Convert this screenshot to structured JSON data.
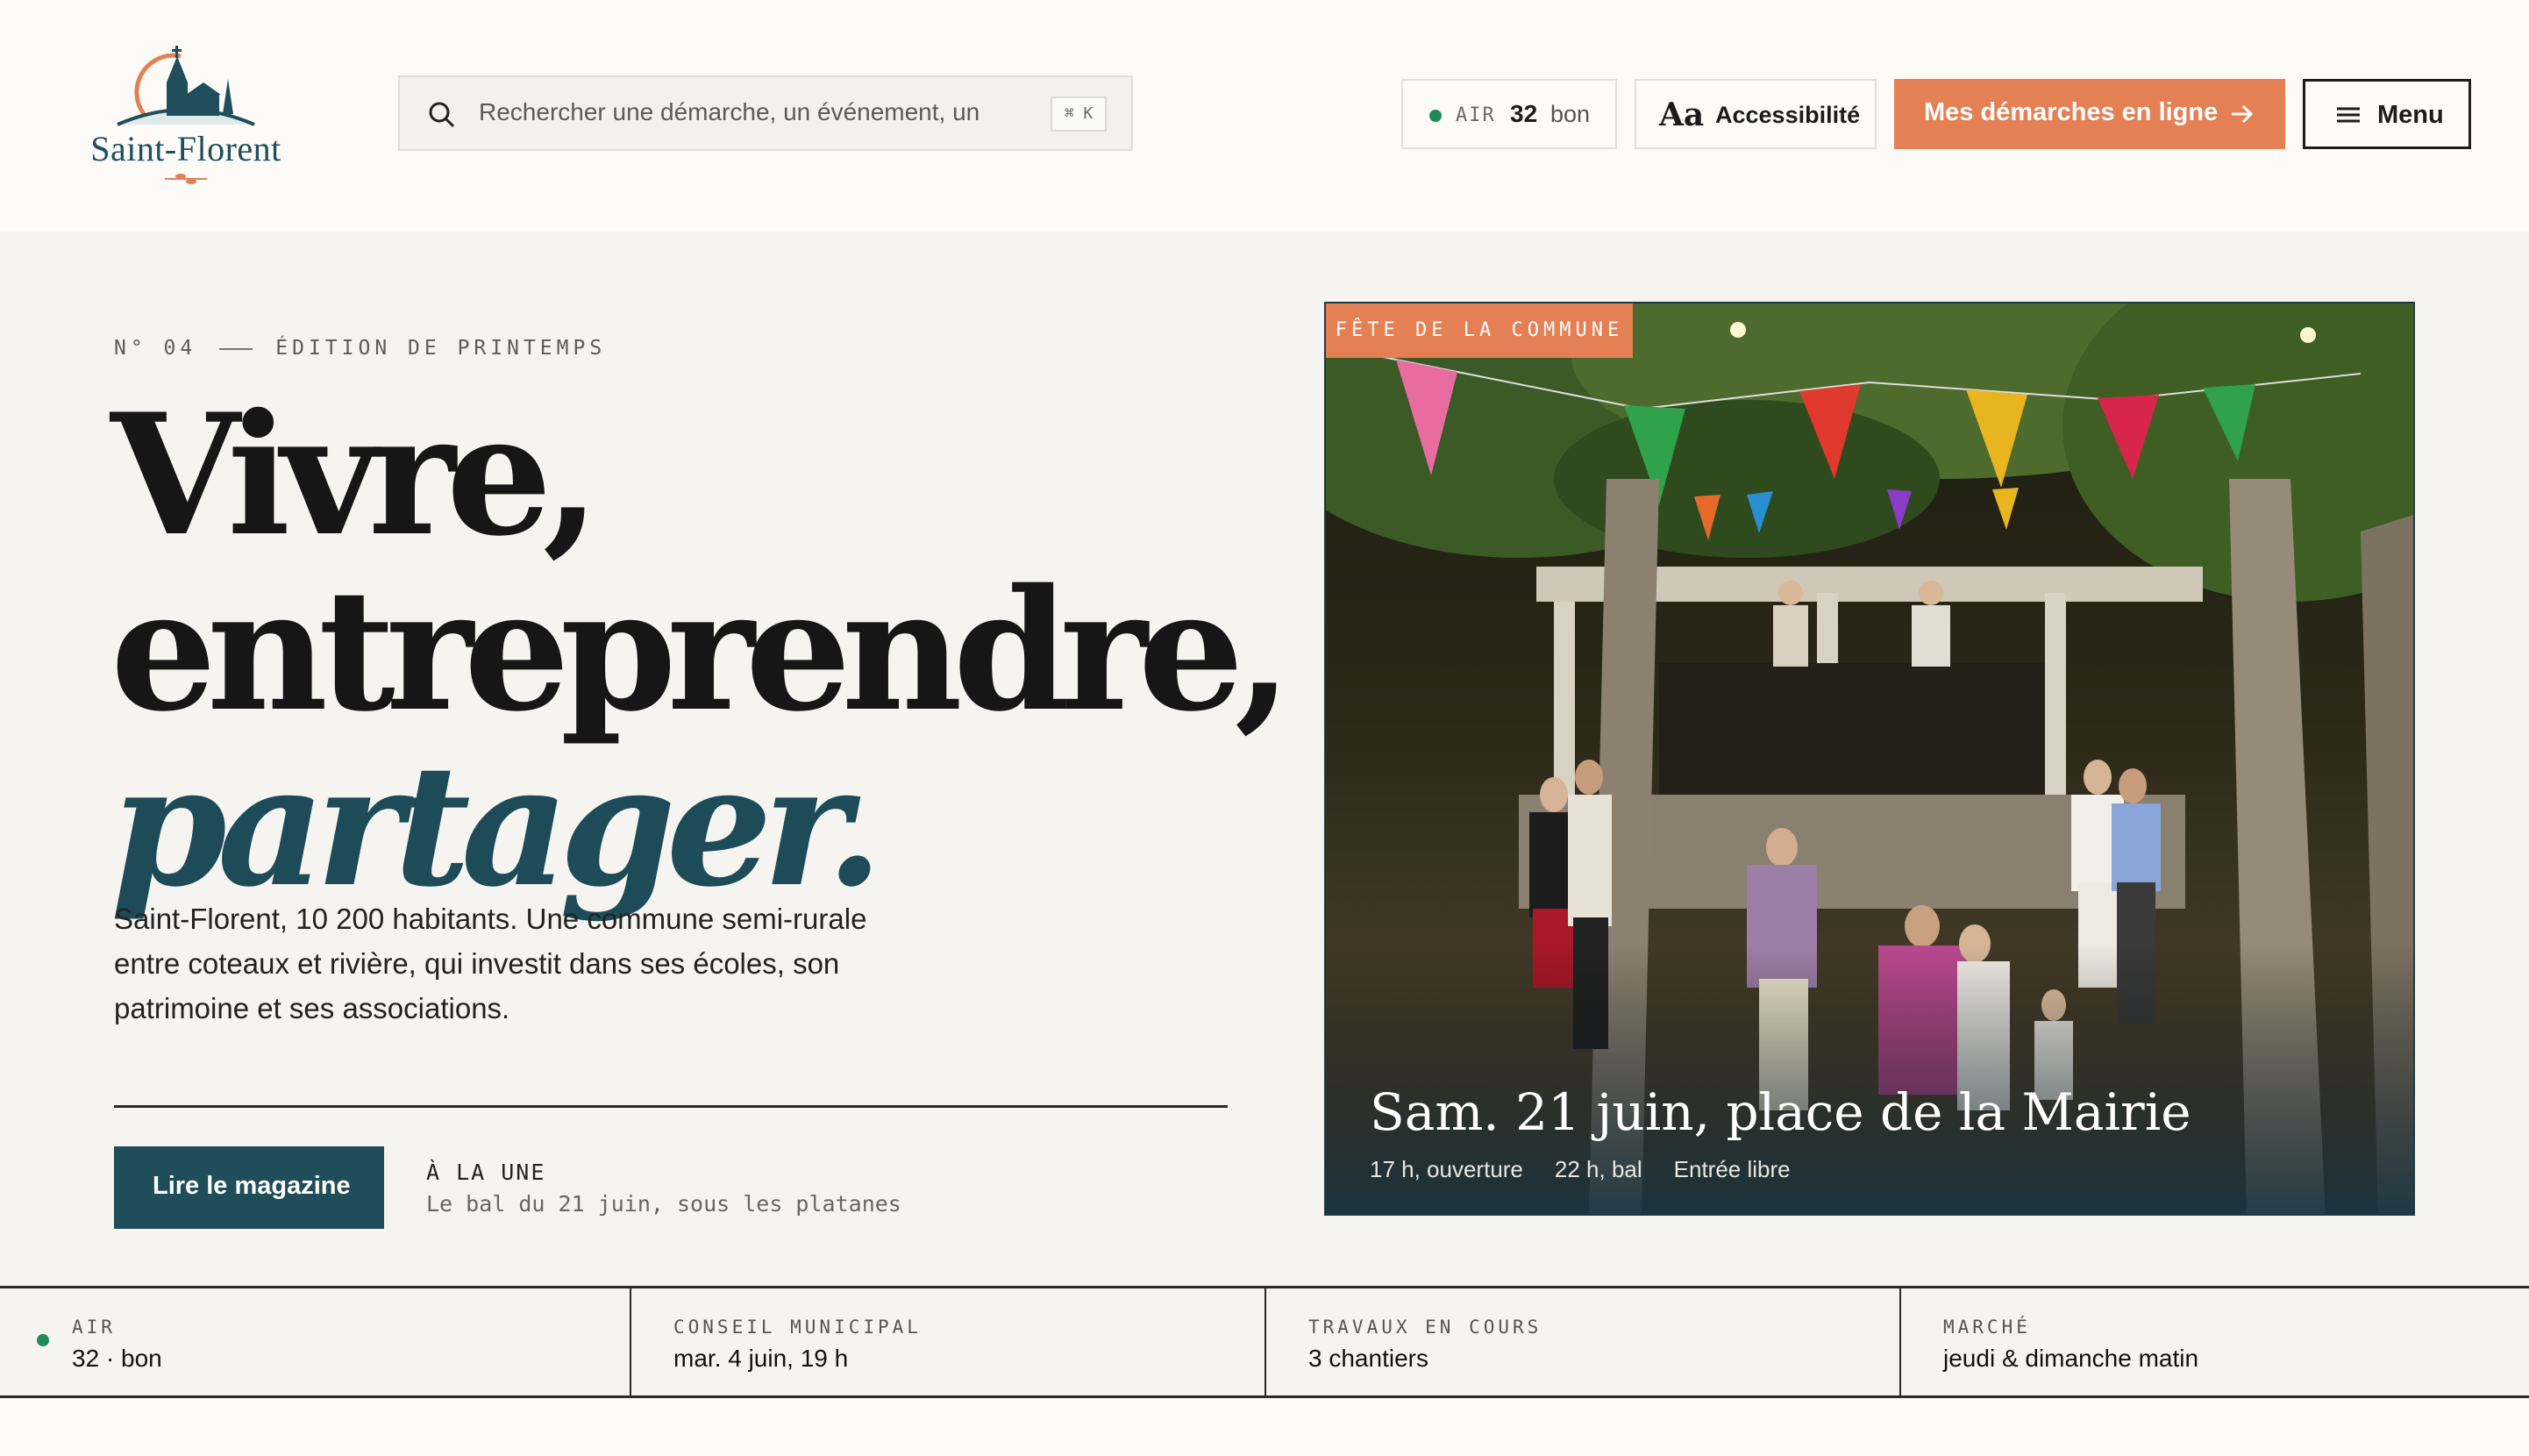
{
  "brand": {
    "name": "Saint-Florent",
    "accent_color": "#e57f54",
    "primary_color": "#1f4d5a"
  },
  "header": {
    "search_placeholder": "Rechercher une démarche, un événement, un",
    "search_shortcut": "⌘ K",
    "air": {
      "label": "AIR",
      "value": "32",
      "status": "bon"
    },
    "accessibility": {
      "icon_text": "Aa",
      "label": "Accessibilité"
    },
    "cta_label": "Mes démarches en ligne",
    "menu_label": "Menu"
  },
  "hero": {
    "issue": "N° 04",
    "edition": "ÉDITION DE PRINTEMPS",
    "title_line1": "Vivre,",
    "title_line2": "entreprendre,",
    "title_line3": "partager.",
    "lead": "Saint-Florent, 10 200 habitants. Une commune semi-rurale entre coteaux et rivière, qui investit dans ses écoles, son patrimoine et ses associations.",
    "read_button": "Lire le magazine",
    "une_label": "À LA UNE",
    "une_text": "Le bal du 21 juin, sous les platanes"
  },
  "feature": {
    "tag": "FÊTE DE LA COMMUNE",
    "title": "Sam. 21 juin, place de la Mairie",
    "meta": [
      "17 h, ouverture",
      "22 h, bal",
      "Entrée libre"
    ]
  },
  "strip": [
    {
      "label": "AIR",
      "value": "32 · bon"
    },
    {
      "label": "CONSEIL MUNICIPAL",
      "value": "mar. 4 juin, 19 h"
    },
    {
      "label": "TRAVAUX EN COURS",
      "value": "3 chantiers"
    },
    {
      "label": "MARCHÉ",
      "value": "jeudi & dimanche matin"
    }
  ]
}
